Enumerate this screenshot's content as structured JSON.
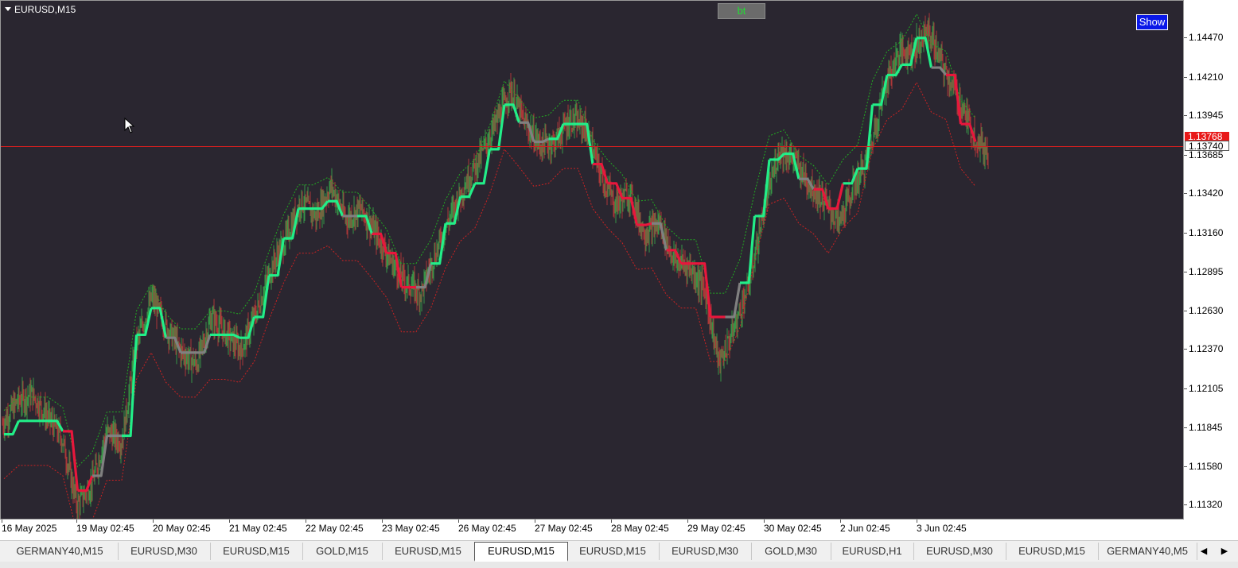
{
  "chart": {
    "symbol_title": "EURUSD,M15",
    "bt_label": "bt",
    "show_label": "Show",
    "bid_price": "1.13768",
    "ask_price": "1.13740",
    "price_levels": [
      "1.14470",
      "1.14210",
      "1.13945",
      "1.13685",
      "1.13420",
      "1.13160",
      "1.12895",
      "1.12630",
      "1.12370",
      "1.12105",
      "1.11845",
      "1.11580",
      "1.11320"
    ],
    "time_labels": [
      "16 May 2025",
      "19 May 02:45",
      "20 May 02:45",
      "21 May 02:45",
      "22 May 02:45",
      "23 May 02:45",
      "26 May 02:45",
      "27 May 02:45",
      "28 May 02:45",
      "29 May 02:45",
      "30 May 02:45",
      "2 Jun 02:45",
      "3 Jun 02:45"
    ],
    "colors": {
      "background": "#2a2630",
      "bull_line": "#22ee88",
      "bear_line": "#e8173c",
      "neutral_line": "#808080",
      "upper_band": "#22aa22",
      "lower_band": "#cc2222",
      "bid_line": "#d81e1e"
    }
  },
  "chart_data": {
    "type": "line",
    "ylim": [
      1.1125,
      1.1475
    ],
    "y_ticks": [
      1.1447,
      1.1421,
      1.13945,
      1.13685,
      1.1342,
      1.1316,
      1.12895,
      1.1263,
      1.1237,
      1.12105,
      1.11845,
      1.1158,
      1.1132
    ],
    "x_labels": [
      "16 May 2025",
      "19 May 02:45",
      "20 May 02:45",
      "21 May 02:45",
      "22 May 02:45",
      "23 May 02:45",
      "26 May 02:45",
      "27 May 02:45",
      "28 May 02:45",
      "29 May 02:45",
      "30 May 02:45",
      "2 Jun 02:45",
      "3 Jun 02:45"
    ],
    "bid": 1.13768,
    "ask": 1.1374,
    "price_path": [
      1.119,
      1.1205,
      1.121,
      1.1195,
      1.118,
      1.1135,
      1.115,
      1.1185,
      1.1178,
      1.1245,
      1.1275,
      1.1255,
      1.1238,
      1.123,
      1.1262,
      1.125,
      1.124,
      1.1265,
      1.1295,
      1.1315,
      1.134,
      1.133,
      1.135,
      1.1328,
      1.1335,
      1.1318,
      1.13,
      1.1285,
      1.1278,
      1.1305,
      1.133,
      1.1352,
      1.137,
      1.1392,
      1.1415,
      1.1392,
      1.1378,
      1.138,
      1.1395,
      1.139,
      1.136,
      1.1338,
      1.1345,
      1.1318,
      1.1325,
      1.13,
      1.1296,
      1.128,
      1.123,
      1.1255,
      1.1285,
      1.1335,
      1.1375,
      1.1368,
      1.1352,
      1.134,
      1.1325,
      1.135,
      1.137,
      1.1415,
      1.144,
      1.1442,
      1.1455,
      1.143,
      1.141,
      1.1385,
      1.1372
    ],
    "signal_line": [
      [
        1.1183,
        "bull"
      ],
      [
        1.1192,
        "bull"
      ],
      [
        1.1192,
        "bull"
      ],
      [
        1.1192,
        "bull"
      ],
      [
        1.1185,
        "bear"
      ],
      [
        1.1145,
        "bear"
      ],
      [
        1.1155,
        "neutral"
      ],
      [
        1.1182,
        "neutral"
      ],
      [
        1.1182,
        "bull"
      ],
      [
        1.125,
        "bull"
      ],
      [
        1.1268,
        "bull"
      ],
      [
        1.1248,
        "neutral"
      ],
      [
        1.1238,
        "neutral"
      ],
      [
        1.1238,
        "neutral"
      ],
      [
        1.125,
        "bull"
      ],
      [
        1.125,
        "bull"
      ],
      [
        1.1248,
        "bull"
      ],
      [
        1.1262,
        "bull"
      ],
      [
        1.129,
        "bull"
      ],
      [
        1.1315,
        "bull"
      ],
      [
        1.1335,
        "bull"
      ],
      [
        1.1335,
        "bull"
      ],
      [
        1.134,
        "bull"
      ],
      [
        1.133,
        "neutral"
      ],
      [
        1.133,
        "bull"
      ],
      [
        1.1318,
        "bear"
      ],
      [
        1.1305,
        "bear"
      ],
      [
        1.1282,
        "bear"
      ],
      [
        1.1282,
        "neutral"
      ],
      [
        1.1298,
        "bull"
      ],
      [
        1.1325,
        "bull"
      ],
      [
        1.1343,
        "bull"
      ],
      [
        1.1352,
        "bull"
      ],
      [
        1.1375,
        "bull"
      ],
      [
        1.1405,
        "bull"
      ],
      [
        1.1393,
        "neutral"
      ],
      [
        1.138,
        "neutral"
      ],
      [
        1.1382,
        "bull"
      ],
      [
        1.1392,
        "bull"
      ],
      [
        1.1392,
        "bull"
      ],
      [
        1.1365,
        "bear"
      ],
      [
        1.1352,
        "bear"
      ],
      [
        1.1342,
        "bear"
      ],
      [
        1.1324,
        "bear"
      ],
      [
        1.1325,
        "neutral"
      ],
      [
        1.1307,
        "bear"
      ],
      [
        1.1298,
        "bear"
      ],
      [
        1.1298,
        "bear"
      ],
      [
        1.1262,
        "bear"
      ],
      [
        1.1262,
        "neutral"
      ],
      [
        1.1285,
        "bull"
      ],
      [
        1.133,
        "bull"
      ],
      [
        1.1368,
        "bull"
      ],
      [
        1.1372,
        "bull"
      ],
      [
        1.1355,
        "neutral"
      ],
      [
        1.1348,
        "bear"
      ],
      [
        1.1335,
        "bear"
      ],
      [
        1.1352,
        "bull"
      ],
      [
        1.1362,
        "bull"
      ],
      [
        1.1405,
        "bull"
      ],
      [
        1.1425,
        "bull"
      ],
      [
        1.1432,
        "bull"
      ],
      [
        1.145,
        "bull"
      ],
      [
        1.143,
        "neutral"
      ],
      [
        1.1425,
        "bear"
      ],
      [
        1.1392,
        "bear"
      ],
      [
        1.138,
        "bear"
      ]
    ]
  },
  "tabs": [
    {
      "label": "GERMANY40,M15",
      "active": false
    },
    {
      "label": "EURUSD,M30",
      "active": false
    },
    {
      "label": "EURUSD,M15",
      "active": false
    },
    {
      "label": "GOLD,M15",
      "active": false
    },
    {
      "label": "EURUSD,M15",
      "active": false
    },
    {
      "label": "EURUSD,M15",
      "active": true
    },
    {
      "label": "EURUSD,M15",
      "active": false
    },
    {
      "label": "EURUSD,M30",
      "active": false
    },
    {
      "label": "GOLD,M30",
      "active": false
    },
    {
      "label": "EURUSD,H1",
      "active": false
    },
    {
      "label": "EURUSD,M30",
      "active": false
    },
    {
      "label": "EURUSD,M15",
      "active": false
    },
    {
      "label": "GERMANY40,M5",
      "active": false
    }
  ],
  "tab_scroll": {
    "left": "◀",
    "right": "▶"
  }
}
